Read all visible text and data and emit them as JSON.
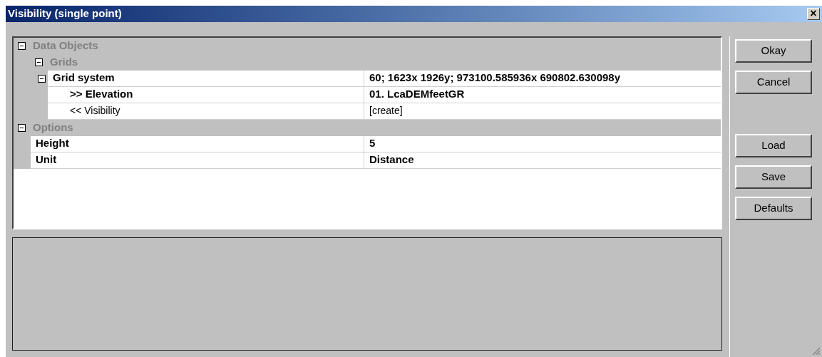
{
  "window": {
    "title": "Visibility (single point)",
    "close": "×"
  },
  "properties": [
    {
      "kind": "category",
      "label": "Data Objects",
      "expanded": true,
      "children": [
        {
          "kind": "category",
          "label": "Grids",
          "expanded": true,
          "children": [
            {
              "kind": "property",
              "label": "Grid system",
              "value": "60; 1623x 1926y; 973100.585936x 690802.630098y",
              "bold": true,
              "expanded": true,
              "children": [
                {
                  "kind": "property",
                  "label": ">> Elevation",
                  "value": "01. LcaDEMfeetGR",
                  "bold": true
                },
                {
                  "kind": "property",
                  "label": "<< Visibility",
                  "value": "[create]",
                  "bold": false
                }
              ]
            }
          ]
        }
      ]
    },
    {
      "kind": "category",
      "label": "Options",
      "expanded": true,
      "children": [
        {
          "kind": "property",
          "label": "Height",
          "value": "5",
          "bold": true
        },
        {
          "kind": "property",
          "label": "Unit",
          "value": "Distance",
          "bold": true
        }
      ]
    }
  ],
  "buttons": [
    "Okay",
    "Cancel",
    "Load",
    "Save",
    "Defaults"
  ]
}
